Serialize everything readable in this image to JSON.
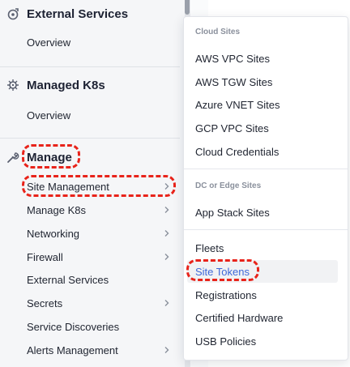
{
  "sidebar": {
    "sections": [
      {
        "title": "External Services",
        "items": [
          {
            "label": "Overview"
          }
        ]
      },
      {
        "title": "Managed K8s",
        "items": [
          {
            "label": "Overview"
          }
        ]
      },
      {
        "title": "Manage",
        "items": [
          {
            "label": "Site Management"
          },
          {
            "label": "Manage K8s"
          },
          {
            "label": "Networking"
          },
          {
            "label": "Firewall"
          },
          {
            "label": "External Services"
          },
          {
            "label": "Secrets"
          },
          {
            "label": "Service Discoveries"
          },
          {
            "label": "Alerts Management"
          }
        ]
      }
    ]
  },
  "dropdown": {
    "groups": [
      {
        "title": "Cloud Sites",
        "items": [
          "AWS VPC Sites",
          "AWS TGW Sites",
          "Azure VNET Sites",
          "GCP VPC Sites",
          "Cloud Credentials"
        ]
      },
      {
        "title": "DC or Edge Sites",
        "items": [
          "App Stack Sites"
        ]
      },
      {
        "title": "",
        "items": [
          "Fleets",
          "Site Tokens",
          "Registrations",
          "Certified Hardware",
          "USB Policies"
        ]
      }
    ],
    "active_item": "Site Tokens"
  },
  "colors": {
    "annotation": "#e8231a",
    "active_link": "#3e68d8"
  }
}
